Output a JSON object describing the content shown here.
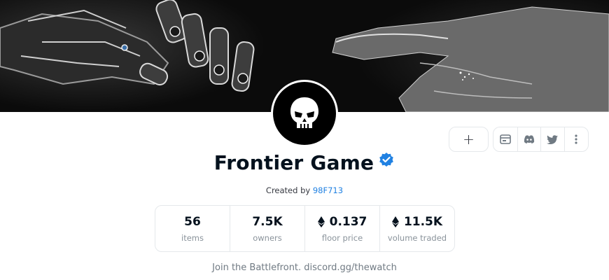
{
  "banner": {
    "alt": "robot hand reaching toward human hand"
  },
  "avatar": {
    "icon": "skull-icon"
  },
  "actions": {
    "add_label": "+",
    "social_buttons": [
      {
        "name": "website-icon"
      },
      {
        "name": "discord-icon"
      },
      {
        "name": "twitter-icon"
      },
      {
        "name": "more-options-icon"
      }
    ]
  },
  "collection": {
    "title": "Frontier Game",
    "verified": true,
    "created_by_label": "Created by",
    "creator": "98F713",
    "description": "Join the Battlefront. discord.gg/thewatch"
  },
  "stats": [
    {
      "value": "56",
      "label": "items",
      "currency_icon": false
    },
    {
      "value": "7.5K",
      "label": "owners",
      "currency_icon": false
    },
    {
      "value": "0.137",
      "label": "floor price",
      "currency_icon": true
    },
    {
      "value": "11.5K",
      "label": "volume traded",
      "currency_icon": true
    }
  ],
  "colors": {
    "accent_link": "#2081e2",
    "verified_badge": "#2081e2",
    "text_primary": "#04111d",
    "text_secondary": "#8a939b",
    "border": "#e5e8eb"
  }
}
